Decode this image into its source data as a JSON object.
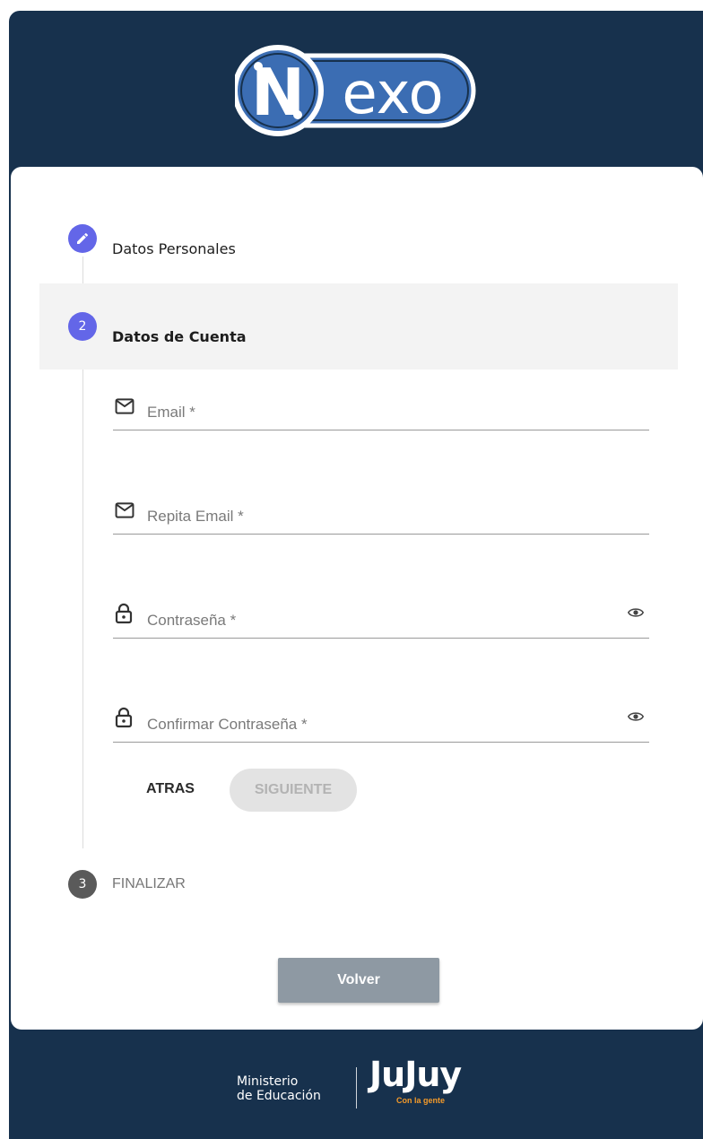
{
  "logo": {
    "text": "exo",
    "initial": "N"
  },
  "stepper": {
    "steps": [
      {
        "number": "",
        "label": "Datos Personales",
        "state": "completed",
        "icon": "pencil-icon"
      },
      {
        "number": "2",
        "label": "Datos de Cuenta",
        "state": "active"
      },
      {
        "number": "3",
        "label": "FINALIZAR",
        "state": "inactive"
      }
    ]
  },
  "form": {
    "email": {
      "label": "Email *",
      "icon": "mail-icon"
    },
    "repeat_email": {
      "label": "Repita Email *",
      "icon": "mail-icon"
    },
    "password": {
      "label": "Contraseña *",
      "icon": "lock-icon"
    },
    "confirm_password": {
      "label": "Confirmar Contraseña *",
      "icon": "lock-icon"
    }
  },
  "buttons": {
    "back": "ATRAS",
    "next": "SIGUIENTE",
    "return": "Volver"
  },
  "footer": {
    "ministry_line1": "Ministerio",
    "ministry_line2": "de Educación",
    "province": "JuJuy",
    "tagline": "Con la gente"
  },
  "colors": {
    "header_bg": "#17314d",
    "accent": "#6366e8",
    "footer_accent": "#f39a2a"
  }
}
